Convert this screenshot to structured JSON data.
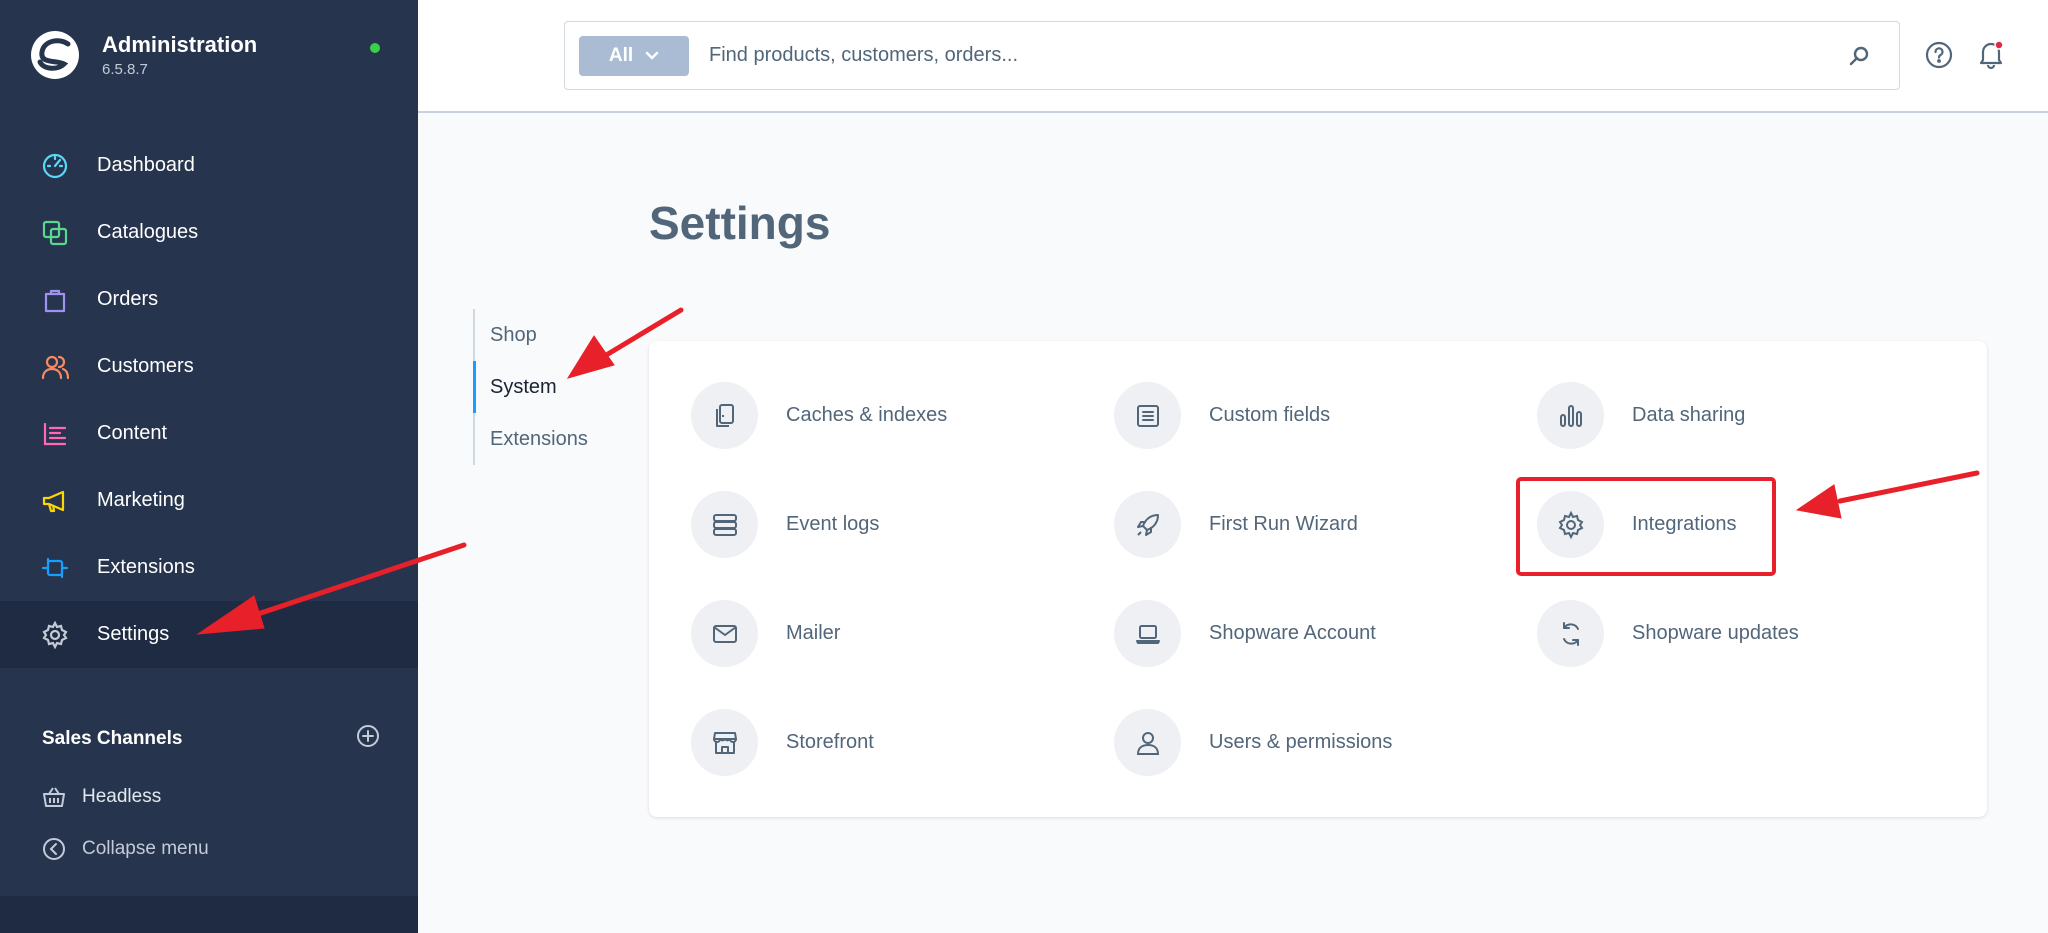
{
  "app": {
    "title": "Administration",
    "version": "6.5.8.7",
    "status_color": "#37d046"
  },
  "sidebar": {
    "items": [
      {
        "label": "Dashboard",
        "icon": "dashboard-icon",
        "color": "#57d9f7"
      },
      {
        "label": "Catalogues",
        "icon": "catalogues-icon",
        "color": "#57d98e"
      },
      {
        "label": "Orders",
        "icon": "orders-icon",
        "color": "#a092f0"
      },
      {
        "label": "Customers",
        "icon": "customers-icon",
        "color": "#f88962"
      },
      {
        "label": "Content",
        "icon": "content-icon",
        "color": "#ff68b4"
      },
      {
        "label": "Marketing",
        "icon": "marketing-icon",
        "color": "#ffd700"
      },
      {
        "label": "Extensions",
        "icon": "extensions-icon",
        "color": "#189eff"
      },
      {
        "label": "Settings",
        "icon": "settings-icon",
        "color": "#c3cbd8",
        "active": true
      }
    ],
    "sales_channels": {
      "title": "Sales Channels",
      "items": [
        {
          "label": "Headless",
          "icon": "basket-icon"
        }
      ]
    },
    "collapse_label": "Collapse menu"
  },
  "search": {
    "filter_label": "All",
    "placeholder": "Find products, customers, orders..."
  },
  "page": {
    "title": "Settings",
    "tabs": [
      {
        "label": "Shop"
      },
      {
        "label": "System",
        "active": true
      },
      {
        "label": "Extensions"
      }
    ]
  },
  "settings_tiles": [
    {
      "label": "Caches & indexes",
      "icon": "caches-icon"
    },
    {
      "label": "Custom fields",
      "icon": "custom-fields-icon"
    },
    {
      "label": "Data sharing",
      "icon": "data-sharing-icon"
    },
    {
      "label": "Event logs",
      "icon": "event-logs-icon"
    },
    {
      "label": "First Run Wizard",
      "icon": "rocket-icon"
    },
    {
      "label": "Integrations",
      "icon": "gear-icon"
    },
    {
      "label": "Mailer",
      "icon": "envelope-icon"
    },
    {
      "label": "Shopware Account",
      "icon": "laptop-icon"
    },
    {
      "label": "Shopware updates",
      "icon": "refresh-icon"
    },
    {
      "label": "Storefront",
      "icon": "storefront-icon"
    },
    {
      "label": "Users & permissions",
      "icon": "user-icon"
    }
  ],
  "annotation_color": "#e8202a"
}
